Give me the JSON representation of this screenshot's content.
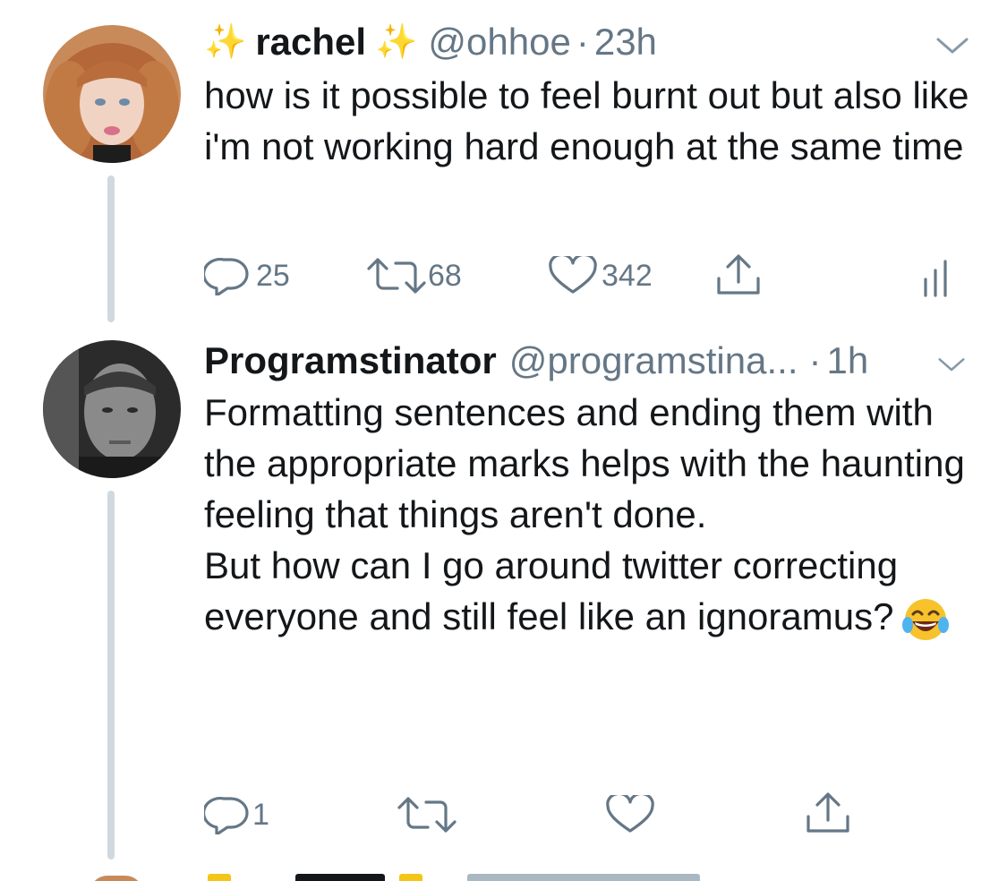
{
  "tweets": [
    {
      "display_name": "rachel",
      "name_decoration": "✨",
      "handle": "@ohhoe",
      "separator": "·",
      "time": "23h",
      "body": [
        "how is it possible to feel burnt out but also like i'm not working hard enough at the same time"
      ],
      "actions": {
        "reply_count": "25",
        "retweet_count": "68",
        "like_count": "342"
      },
      "icons": [
        "chevron-down-icon",
        "reply-icon",
        "retweet-icon",
        "like-icon",
        "share-icon",
        "analytics-icon"
      ]
    },
    {
      "display_name": "Programstinator",
      "handle": "@programstina...",
      "separator": "·",
      "time": "1h",
      "body": [
        "Formatting sentences and ending them with the appropriate marks helps with the haunting feeling that things aren't done.",
        "But how can I go around twitter correcting everyone and still feel like an ignoramus?"
      ],
      "emoji": "face-with-tears-of-joy",
      "actions": {
        "reply_count": "1"
      },
      "icons": [
        "chevron-down-icon",
        "reply-icon",
        "retweet-icon",
        "like-icon",
        "share-icon"
      ]
    }
  ],
  "colors": {
    "text": "#14171a",
    "muted": "#657786",
    "thread_line": "#cfd9de",
    "sparkle": "#f5c518"
  }
}
